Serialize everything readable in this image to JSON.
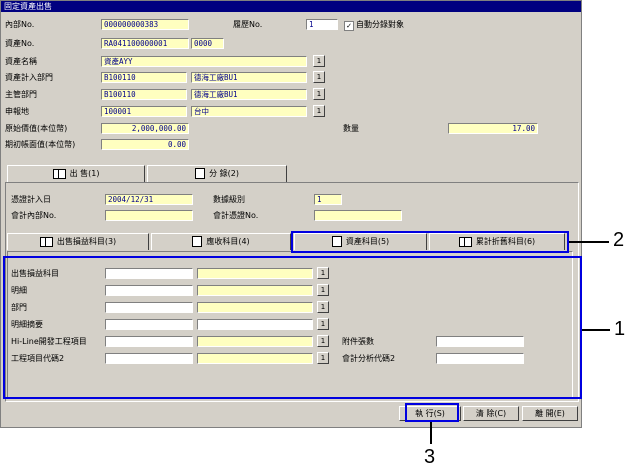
{
  "window": {
    "title": "固定資產出售"
  },
  "header": {
    "internal_no_label": "內部No.",
    "internal_no": "000000000383",
    "history_no_label": "履歷No.",
    "history_no": "1",
    "auto_split_label": "自動分錄對象",
    "auto_split_checked": true,
    "asset_no_label": "資產No.",
    "asset_no": "RA041100000001",
    "asset_sub_no": "0000",
    "asset_name_label": "資產名稱",
    "asset_name": "資產AYY",
    "asset_dept_label": "資產計入部門",
    "asset_dept_code": "B100110",
    "asset_dept_name": "德海工廠BU1",
    "main_dept_label": "主管部門",
    "main_dept_code": "B100110",
    "main_dept_name": "德海工廠BU1",
    "report_place_label": "申報地",
    "report_place_code": "100001",
    "report_place_name": "台中",
    "orig_value_label": "原始價值(本位幣)",
    "orig_value": "2,000,000.00",
    "quantity_label": "數量",
    "quantity": "17.00",
    "opening_book_label": "期初帳面值(本位幣)",
    "opening_book_value": "0.00",
    "lookup_btn": "1"
  },
  "main_tabs": [
    {
      "label": "出  售(1)"
    },
    {
      "label": "分  錄(2)"
    }
  ],
  "voucher": {
    "date_label": "憑證計入日",
    "date_value": "2004/12/31",
    "level_label": "數據級別",
    "level_value": "1",
    "acct_internal_label": "會計內部No.",
    "acct_voucher_label": "會計憑證No."
  },
  "sub_tabs": [
    {
      "label": "出售損益科目(3)"
    },
    {
      "label": "應收科目(4)"
    },
    {
      "label": "資產科目(5)"
    },
    {
      "label": "累計折舊科目(6)"
    }
  ],
  "detail": {
    "rows": [
      {
        "label": "出售損益科目"
      },
      {
        "label": "明細"
      },
      {
        "label": "部門"
      },
      {
        "label": "明細摘要"
      },
      {
        "label": "Hi-Line開發工程項目"
      },
      {
        "label": "工程項目代碼2"
      }
    ],
    "attach_label": "附件張數",
    "analysis_label": "會計分析代碼2"
  },
  "buttons": {
    "execute": "執 行(S)",
    "clear": "清 除(C)",
    "close": "離 開(E)"
  },
  "callouts": {
    "c1": "1",
    "c2": "2",
    "c3": "3"
  }
}
